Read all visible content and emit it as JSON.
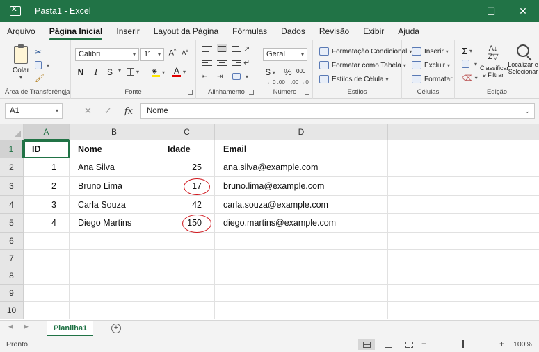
{
  "window": {
    "title": "Pasta1  -  Excel",
    "minimize": "—",
    "restore": "☐",
    "close": "✕"
  },
  "tabs": [
    "Arquivo",
    "Página Inicial",
    "Inserir",
    "Layout da Página",
    "Fórmulas",
    "Dados",
    "Revisão",
    "Exibir",
    "Ajuda"
  ],
  "active_tab": "Página Inicial",
  "ribbon": {
    "clipboard": {
      "label": "Área de Transferência",
      "paste": "Colar"
    },
    "font": {
      "label": "Fonte",
      "name": "Calibri",
      "size": "11",
      "bold": "N",
      "italic": "I",
      "underline": "S"
    },
    "alignment": {
      "label": "Alinhamento"
    },
    "number": {
      "label": "Número",
      "format": "Geral",
      "currency": "$",
      "percent": "%",
      "thousands": "000"
    },
    "styles": {
      "label": "Estilos",
      "conditional": "Formatação Condicional",
      "as_table": "Formatar como Tabela",
      "cell_styles": "Estilos de Célula"
    },
    "cells": {
      "label": "Células",
      "insert": "Inserir",
      "delete": "Excluir",
      "format": "Formatar"
    },
    "editing": {
      "label": "Edição",
      "sort1": "Classificar",
      "sort2": "e Filtrar",
      "find1": "Localizar e",
      "find2": "Selecionar"
    }
  },
  "formula_bar": {
    "name_box": "A1",
    "formula": "Nome",
    "fx": "fx",
    "cancel": "✕",
    "enter": "✓"
  },
  "columns": [
    "A",
    "B",
    "C",
    "D"
  ],
  "rows": [
    "1",
    "2",
    "3",
    "4",
    "5",
    "6",
    "7",
    "8",
    "9",
    "10"
  ],
  "table": {
    "headers": [
      "ID",
      "Nome",
      "Idade",
      "Email"
    ],
    "records": [
      [
        "1",
        "Ana Silva",
        "25",
        "ana.silva@example.com"
      ],
      [
        "2",
        "Bruno Lima",
        "17",
        "bruno.lima@example.com"
      ],
      [
        "3",
        "Carla Souza",
        "42",
        "carla.souza@example.com"
      ],
      [
        "4",
        "Diego Martins",
        "150",
        "diego.martins@example.com"
      ]
    ]
  },
  "highlight_color": "#d0181e",
  "sheet": {
    "name": "Planilha1",
    "add": "+"
  },
  "status": {
    "text": "Pronto",
    "zoom": "100%",
    "zoom_minus": "−",
    "zoom_plus": "+"
  }
}
